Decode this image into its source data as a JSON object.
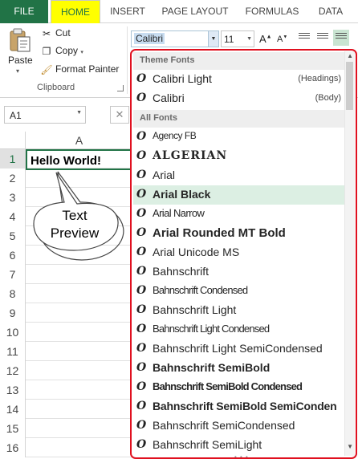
{
  "tabs": {
    "file": "FILE",
    "home": "HOME",
    "insert": "INSERT",
    "page_layout": "PAGE LAYOUT",
    "formulas": "FORMULAS",
    "data": "DATA"
  },
  "clipboard": {
    "paste": "Paste",
    "cut": "Cut",
    "copy": "Copy",
    "format_painter": "Format Painter",
    "group_label": "Clipboard"
  },
  "font": {
    "name": "Calibri",
    "size": "11"
  },
  "formula_bar": {
    "name_box": "A1"
  },
  "grid": {
    "column": "A",
    "rows": [
      "1",
      "2",
      "3",
      "4",
      "5",
      "6",
      "7",
      "8",
      "9",
      "10",
      "11",
      "12",
      "13",
      "14",
      "15",
      "16"
    ],
    "a1_value": "Hello World!"
  },
  "callout": {
    "line1": "Text",
    "line2": "Preview"
  },
  "font_menu": {
    "theme_header": "Theme Fonts",
    "theme_fonts": [
      {
        "name": "Calibri Light",
        "tag": "(Headings)"
      },
      {
        "name": "Calibri",
        "tag": "(Body)"
      }
    ],
    "all_header": "All Fonts",
    "all_fonts": [
      "Agency FB",
      "ALGERIAN",
      "Arial",
      "Arial Black",
      "Arial Narrow",
      "Arial Rounded MT Bold",
      "Arial Unicode MS",
      "Bahnschrift",
      "Bahnschrift Condensed",
      "Bahnschrift Light",
      "Bahnschrift Light Condensed",
      "Bahnschrift Light SemiCondensed",
      "Bahnschrift SemiBold",
      "Bahnschrift SemiBold Condensed",
      "Bahnschrift SemiBold SemiConden",
      "Bahnschrift SemiCondensed",
      "Bahnschrift SemiLight"
    ],
    "highlighted": "Arial Black"
  },
  "colors": {
    "excel_green": "#217346",
    "home_tab_highlight": "#ffff00",
    "dropdown_outline": "#e0101f",
    "hover_row": "#dcefe3"
  },
  "icons": [
    "paste-icon",
    "cut-icon",
    "copy-icon",
    "format-painter-icon",
    "font-type-icon"
  ]
}
